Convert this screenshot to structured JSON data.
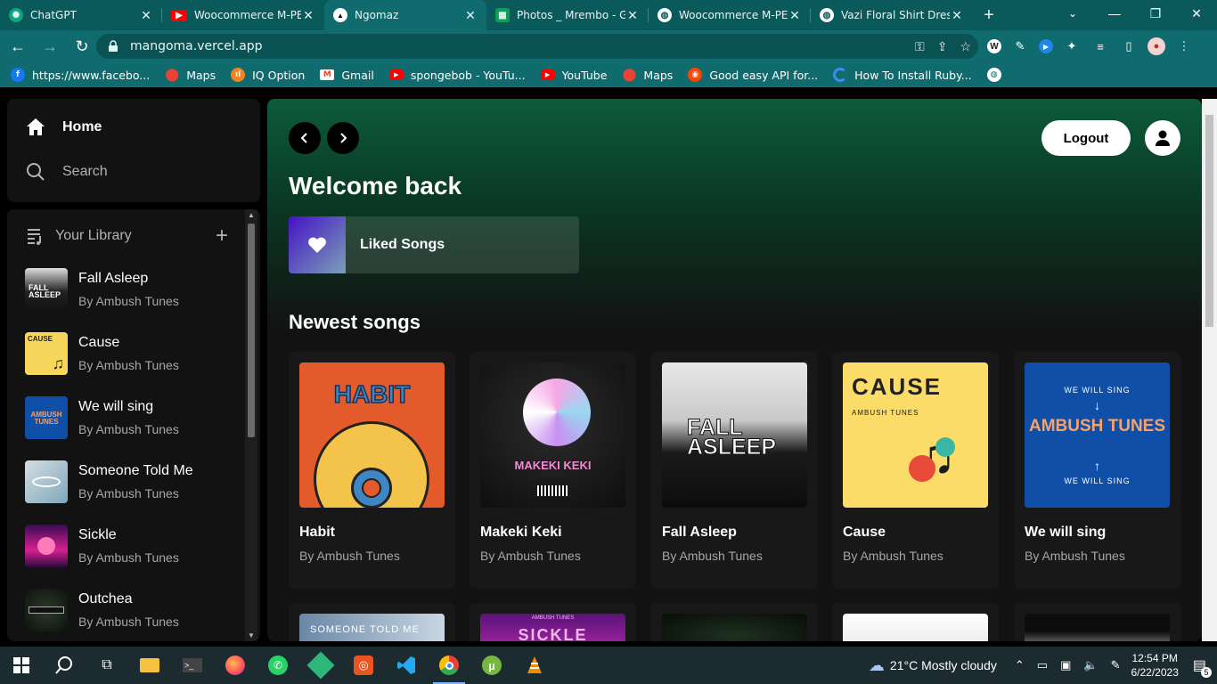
{
  "browser": {
    "tabs": [
      {
        "title": "ChatGPT",
        "icon": "chatgpt-icon",
        "color": "#10a37f"
      },
      {
        "title": "Woocommerce M-PESA",
        "icon": "youtube-icon",
        "color": "#ff0000"
      },
      {
        "title": "Ngomaz",
        "icon": "vercel-icon",
        "color": "#000000",
        "active": true
      },
      {
        "title": "Photos _ Mrembo - Go",
        "icon": "sheets-icon",
        "color": "#0f9d58"
      },
      {
        "title": "Woocommerce M-PESA",
        "icon": "globe-icon",
        "color": "#ffffff"
      },
      {
        "title": "Vazi Floral Shirt Dress",
        "icon": "globe-icon",
        "color": "#ffffff"
      }
    ],
    "url": "mangoma.vercel.app",
    "bookmarks": [
      {
        "label": "https://www.facebo...",
        "icon": "facebook-icon",
        "color": "#1877f2"
      },
      {
        "label": "Maps",
        "icon": "maps-icon",
        "color": "#34a853"
      },
      {
        "label": "IQ Option",
        "icon": "iqoption-icon",
        "color": "#f58220"
      },
      {
        "label": "Gmail",
        "icon": "gmail-icon",
        "color": "#ea4335"
      },
      {
        "label": "spongebob - YouTu...",
        "icon": "youtube-icon",
        "color": "#ff0000"
      },
      {
        "label": "YouTube",
        "icon": "youtube-icon",
        "color": "#ff0000"
      },
      {
        "label": "Maps",
        "icon": "maps-icon",
        "color": "#34a853"
      },
      {
        "label": "Good easy API for...",
        "icon": "reddit-icon",
        "color": "#ff4500"
      },
      {
        "label": "How To Install Ruby...",
        "icon": "loader-icon",
        "color": "#3a8ee6"
      }
    ]
  },
  "sidebar": {
    "nav": [
      {
        "label": "Home",
        "icon": "home-icon"
      },
      {
        "label": "Search",
        "icon": "search-icon"
      }
    ],
    "library_title": "Your Library",
    "library": [
      {
        "title": "Fall Asleep",
        "subtitle": "By Ambush Tunes"
      },
      {
        "title": "Cause",
        "subtitle": "By Ambush Tunes"
      },
      {
        "title": "We will sing",
        "subtitle": "By Ambush Tunes"
      },
      {
        "title": "Someone Told Me",
        "subtitle": "By Ambush Tunes"
      },
      {
        "title": "Sickle",
        "subtitle": "By Ambush Tunes"
      },
      {
        "title": "Outchea",
        "subtitle": "By Ambush Tunes"
      }
    ]
  },
  "main": {
    "logout_label": "Logout",
    "welcome": "Welcome back",
    "liked_label": "Liked Songs",
    "section_title": "Newest songs",
    "cards": [
      {
        "title": "Habit",
        "subtitle": "By Ambush Tunes",
        "art_text": "HABIT"
      },
      {
        "title": "Makeki Keki",
        "subtitle": "By Ambush Tunes",
        "art_text": "MAKEKI KEKI"
      },
      {
        "title": "Fall Asleep",
        "subtitle": "By Ambush Tunes",
        "art_text": "FALL ASLEEP"
      },
      {
        "title": "Cause",
        "subtitle": "By Ambush Tunes",
        "art_text": "CAUSE",
        "art_sub": "AMBUSH TUNES"
      },
      {
        "title": "We will sing",
        "subtitle": "By Ambush Tunes",
        "art_text": "AMBUSH TUNES",
        "art_sub": "WE WILL SING"
      }
    ],
    "row2_art": [
      "SOMEONE TOLD ME",
      "SICKLE",
      "",
      "",
      ""
    ]
  },
  "taskbar": {
    "weather": "21°C  Mostly cloudy",
    "time": "12:54 PM",
    "date": "6/22/2023",
    "notifications": "5"
  }
}
